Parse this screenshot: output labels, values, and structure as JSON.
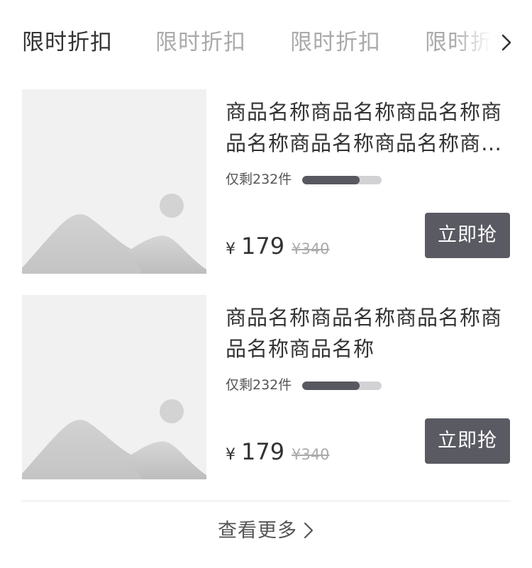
{
  "tabs": [
    {
      "label": "限时折扣",
      "active": true
    },
    {
      "label": "限时折扣",
      "active": false
    },
    {
      "label": "限时折扣",
      "active": false
    },
    {
      "label": "限时折扣",
      "active": false
    }
  ],
  "tabs_more_icon": "chevron-right-icon",
  "products": [
    {
      "title": "商品名称商品名称商品名称商品名称商品名称商品名称商品名称商品名称",
      "stock_text": "仅剩232件",
      "stock_progress": 0.72,
      "currency": "¥",
      "price": "179",
      "original_price": "¥340",
      "buy_label": "立即抢",
      "image_icon": "image-placeholder-icon"
    },
    {
      "title": "商品名称商品名称商品名称商品名称商品名称",
      "stock_text": "仅剩232件",
      "stock_progress": 0.72,
      "currency": "¥",
      "price": "179",
      "original_price": "¥340",
      "buy_label": "立即抢",
      "image_icon": "image-placeholder-icon"
    }
  ],
  "footer": {
    "more_label": "查看更多",
    "more_icon": "chevron-right-icon"
  },
  "colors": {
    "button_bg": "#5a5a63",
    "progress_fill": "#585860",
    "progress_track": "#d2d2d4",
    "placeholder_bg": "#f1f1f1"
  }
}
